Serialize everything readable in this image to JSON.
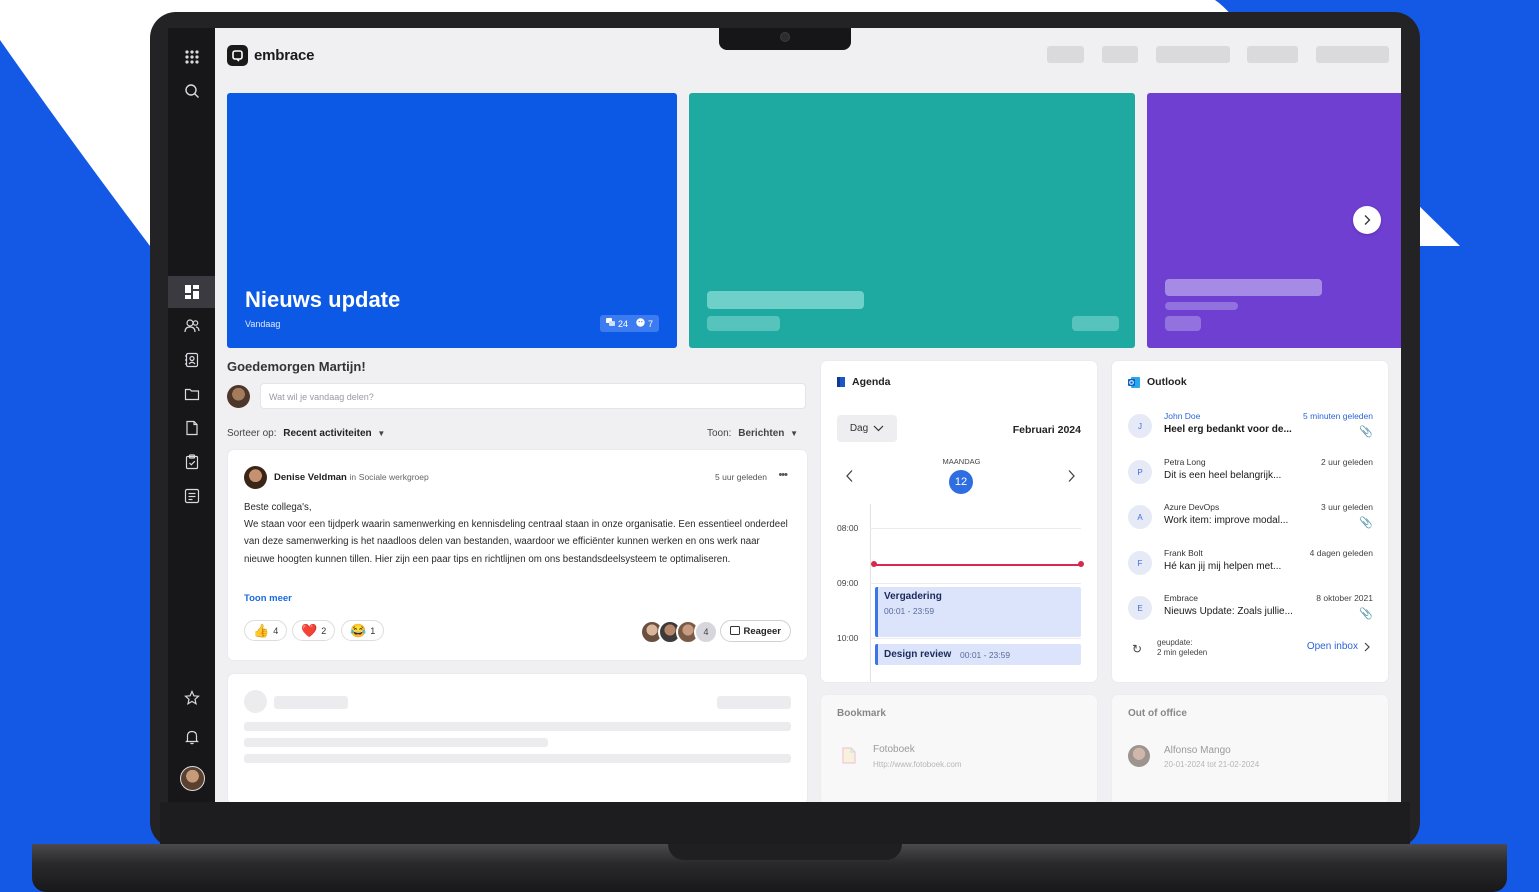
{
  "app": {
    "logo_text": "embrace"
  },
  "hero": {
    "title": "Nieuws update",
    "subtitle": "Vandaag",
    "comments": "24",
    "reactions": "7",
    "colors": [
      "#0c59e6",
      "#1eaaa0",
      "#6f3fd2"
    ]
  },
  "feed": {
    "greeting": "Goedemorgen Martijn!",
    "input_placeholder": "Wat wil je vandaag delen?",
    "sort_label": "Sorteer op:",
    "sort_value": "Recent activiteiten",
    "show_label": "Toon:",
    "show_value": "Berichten",
    "post": {
      "author": "Denise Veldman",
      "group_prefix": "in",
      "group": "Sociale werkgroep",
      "time": "5 uur geleden",
      "greeting_line": "Beste collega's,",
      "body": "We staan voor een tijdperk waarin samenwerking en kennisdeling centraal staan in onze organisatie. Een essentieel onderdeel van deze samenwerking is het naadloos delen van bestanden, waardoor we efficiënter kunnen werken en ons werk naar nieuwe hoogten kunnen tillen. Hier zijn een paar tips en richtlijnen om ons bestandsdeelsysteem te optimaliseren.",
      "show_more": "Toon meer",
      "reactions": [
        {
          "emoji": "👍",
          "count": "4"
        },
        {
          "emoji": "❤️",
          "count": "2"
        },
        {
          "emoji": "😂",
          "count": "1"
        }
      ],
      "reactor_count": "4",
      "reply_label": "Reageer"
    }
  },
  "agenda": {
    "title": "Agenda",
    "view": "Dag",
    "month": "Februari 2024",
    "weekday": "MAANDAG",
    "day": "12",
    "hours": [
      "08:00",
      "09:00",
      "10:00"
    ],
    "events": [
      {
        "title": "Vergadering",
        "time": "00:01 - 23:59"
      },
      {
        "title": "Design review",
        "time": "00:01 - 23:59"
      }
    ]
  },
  "outlook": {
    "title": "Outlook",
    "mails": [
      {
        "initial": "J",
        "from": "John Doe",
        "subject": "Heel erg bedankt voor de...",
        "time": "5 minuten geleden",
        "unread": true,
        "attachment": true
      },
      {
        "initial": "P",
        "from": "Petra Long",
        "subject": "Dit is een heel belangrijk...",
        "time": "2 uur geleden",
        "unread": false,
        "attachment": false
      },
      {
        "initial": "A",
        "from": "Azure DevOps",
        "subject": "Work item: improve modal...",
        "time": "3 uur geleden",
        "unread": false,
        "attachment": true
      },
      {
        "initial": "F",
        "from": "Frank Bolt",
        "subject": "Hé kan jij mij helpen met...",
        "time": "4 dagen geleden",
        "unread": false,
        "attachment": false
      },
      {
        "initial": "E",
        "from": "Embrace",
        "subject": "Nieuws Update: Zoals jullie...",
        "time": "8 oktober 2021",
        "unread": false,
        "attachment": true
      }
    ],
    "updated_label": "geupdate:",
    "updated_time": "2 min geleden",
    "open_inbox": "Open inbox"
  },
  "bookmark": {
    "title": "Bookmark",
    "item_name": "Fotoboek",
    "item_url": "Http://www.fotoboek.com"
  },
  "out_of_office": {
    "title": "Out of office",
    "name": "Alfonso Mango",
    "dates": "20-01-2024 tot 21-02-2024"
  }
}
